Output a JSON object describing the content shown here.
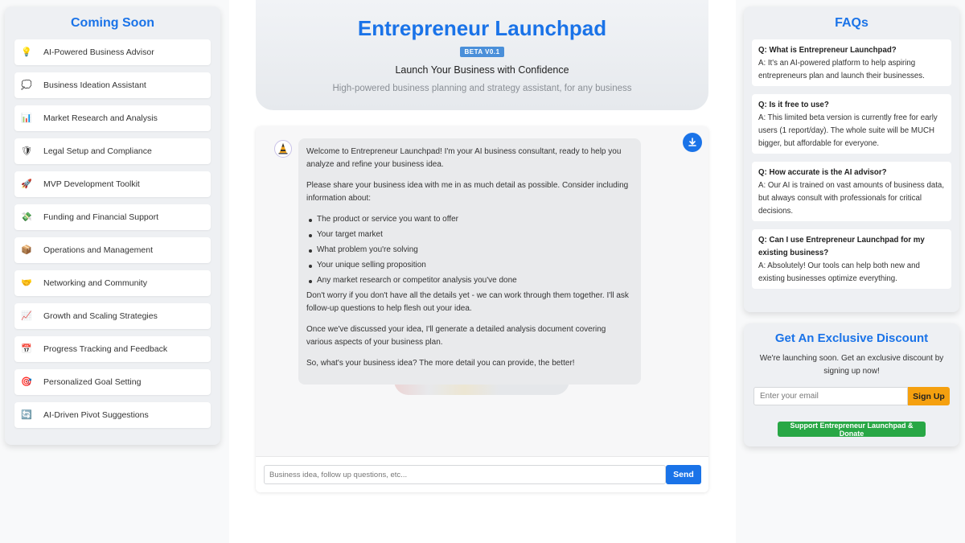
{
  "coming_soon": {
    "title": "Coming Soon",
    "items": [
      {
        "label": "AI-Powered Business Advisor",
        "icon": "lightbulb-icon",
        "glyph": "💡"
      },
      {
        "label": "Business Ideation Assistant",
        "icon": "thought-bubble-icon",
        "glyph": "💭"
      },
      {
        "label": "Market Research and Analysis",
        "icon": "bar-chart-icon",
        "glyph": "📊"
      },
      {
        "label": "Legal Setup and Compliance",
        "icon": "shield-icon",
        "glyph": "🛡"
      },
      {
        "label": "MVP Development Toolkit",
        "icon": "rocket-icon",
        "glyph": "🚀"
      },
      {
        "label": "Funding and Financial Support",
        "icon": "money-icon",
        "glyph": "💸"
      },
      {
        "label": "Operations and Management",
        "icon": "package-icon",
        "glyph": "📦"
      },
      {
        "label": "Networking and Community",
        "icon": "handshake-icon",
        "glyph": "🤝"
      },
      {
        "label": "Growth and Scaling Strategies",
        "icon": "trend-chart-icon",
        "glyph": "📈"
      },
      {
        "label": "Progress Tracking and Feedback",
        "icon": "calendar-icon",
        "glyph": "📅"
      },
      {
        "label": "Personalized Goal Setting",
        "icon": "target-icon",
        "glyph": "🎯"
      },
      {
        "label": "AI-Driven Pivot Suggestions",
        "icon": "pivot-arrows-icon",
        "glyph": "🔄"
      }
    ]
  },
  "header": {
    "title": "Entrepreneur Launchpad",
    "badge": "BETA V0.1",
    "tagline": "Launch Your Business with Confidence",
    "subtitle": "High-powered business planning and strategy assistant, for any business"
  },
  "chat": {
    "download_icon": "download-icon",
    "avatar_icon": "assistant-avatar-icon",
    "message": {
      "p1": "Welcome to Entrepreneur Launchpad! I'm your AI business consultant, ready to help you analyze and refine your business idea.",
      "p2": "Please share your business idea with me in as much detail as possible. Consider including information about:",
      "list": [
        "The product or service you want to offer",
        "Your target market",
        "What problem you're solving",
        "Your unique selling proposition",
        "Any market research or competitor analysis you've done"
      ],
      "p3": "Don't worry if you don't have all the details yet - we can work through them together. I'll ask follow-up questions to help flesh out your idea.",
      "p4": "Once we've discussed your idea, I'll generate a detailed analysis document covering various aspects of your business plan.",
      "p5": "So, what's your business idea? The more detail you can provide, the better!"
    },
    "input_placeholder": "Business idea, follow up questions, etc...",
    "input_value": "",
    "send_label": "Send"
  },
  "faqs": {
    "title": "FAQs",
    "items": [
      {
        "q": "Q: What is Entrepreneur Launchpad?",
        "a": "A: It's an AI-powered platform to help aspiring entrepreneurs plan and launch their businesses."
      },
      {
        "q": "Q: Is it free to use?",
        "a": "A: This limited beta version is currently free for early users (1 report/day). The whole suite will be MUCH bigger, but affordable for everyone."
      },
      {
        "q": "Q: How accurate is the AI advisor?",
        "a": "A: Our AI is trained on vast amounts of business data, but always consult with professionals for critical decisions."
      },
      {
        "q": "Q: Can I use Entrepreneur Launchpad for my existing business?",
        "a": "A: Absolutely! Our tools can help both new and existing businesses optimize everything."
      }
    ]
  },
  "discount": {
    "title": "Get An Exclusive Discount",
    "text": "We're launching soon. Get an exclusive discount by signing up now!",
    "email_placeholder": "Enter your email",
    "email_value": "",
    "signup_label": "Sign Up",
    "donate_label": "Support Entrepreneur Launchpad & Donate"
  },
  "colors": {
    "accent": "#1a73e8",
    "badge": "#4a8fd9",
    "signup": "#f5a00f",
    "donate": "#28a745"
  }
}
